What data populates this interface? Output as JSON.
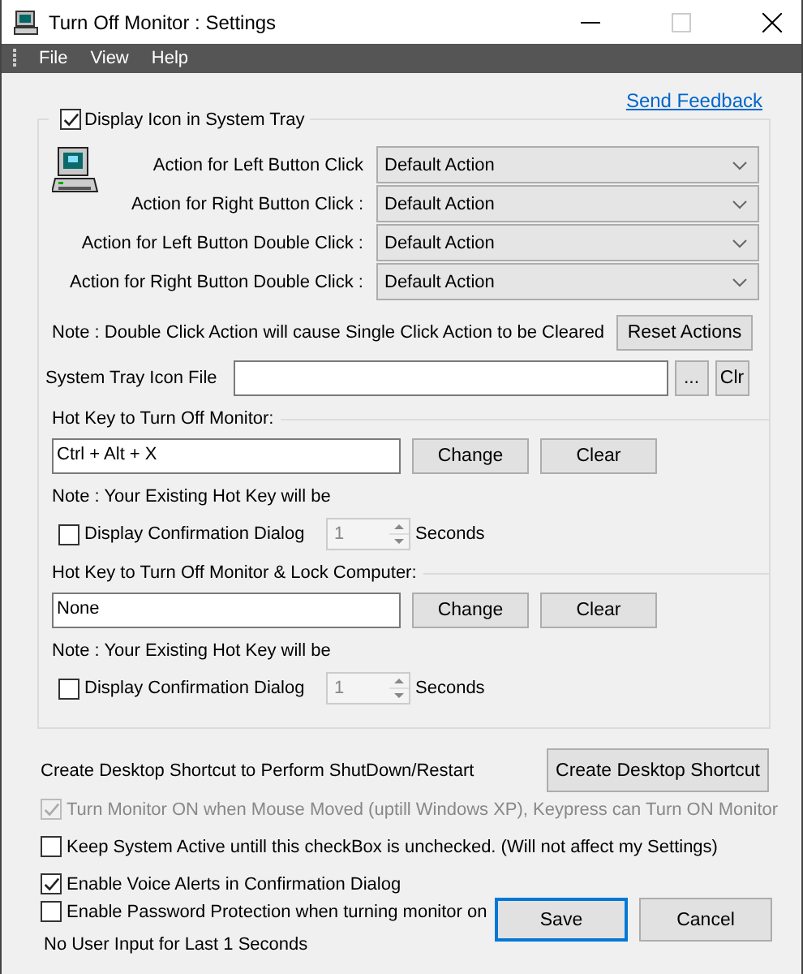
{
  "window": {
    "title": "Turn Off Monitor : Settings"
  },
  "menu": [
    {
      "label": "File"
    },
    {
      "label": "View"
    },
    {
      "label": "Help"
    }
  ],
  "send_feedback": "Send Feedback",
  "tray": {
    "label": "Display Icon in System Tray",
    "checked": true
  },
  "actions": [
    {
      "label": "Action for Left Button Click",
      "value": "Default Action"
    },
    {
      "label": "Action for Right Button Click :",
      "value": "Default Action"
    },
    {
      "label": "Action for Left Button Double Click :",
      "value": "Default Action"
    },
    {
      "label": "Action for Right Button Double Click :",
      "value": "Default Action"
    }
  ],
  "note": "Note : Double Click Action will cause Single Click Action to be Cleared",
  "reset_button": "Reset Actions",
  "icon_file": {
    "label": "System Tray Icon File",
    "browse": "...",
    "clear": "Clr"
  },
  "hotkeys": [
    {
      "heading": "Hot Key to Turn Off Monitor:",
      "value": "Ctrl + Alt + X",
      "change": "Change",
      "clear": "Clear",
      "note": "Note : Your Existing Hot Key will be",
      "confirm": {
        "label": "Display Confirmation Dialog",
        "checked": false
      },
      "delay": {
        "value": "1",
        "disabled": true
      },
      "unit": "Seconds"
    },
    {
      "heading": "Hot Key to Turn Off Monitor & Lock Computer:",
      "value": "None",
      "change": "Change",
      "clear": "Clear",
      "note": "Note : Your Existing Hot Key will be",
      "confirm": {
        "label": "Display Confirmation Dialog",
        "checked": false
      },
      "delay": {
        "value": "1",
        "disabled": true
      },
      "unit": "Seconds"
    }
  ],
  "shortcut": {
    "label": "Create Desktop Shortcut to Perform ShutDown/Restart",
    "button": "Create Desktop Shortcut"
  },
  "options": [
    {
      "label": "Turn Monitor ON when Mouse Moved (uptill Windows XP), Keypress can Turn ON Monitor",
      "checked": true,
      "disabled": true
    },
    {
      "label": "Keep System Active untill this checkBox is unchecked.  (Will not affect my Settings)",
      "checked": false,
      "disabled": false
    },
    {
      "label": "Enable Voice Alerts in Confirmation Dialog",
      "checked": true,
      "disabled": false
    },
    {
      "label": "Enable Password Protection when turning monitor on",
      "checked": false,
      "disabled": false
    }
  ],
  "status": "No User Input for Last 1 Seconds",
  "buttons": [
    {
      "label": "Save",
      "default": true
    },
    {
      "label": "Cancel",
      "default": false
    }
  ]
}
